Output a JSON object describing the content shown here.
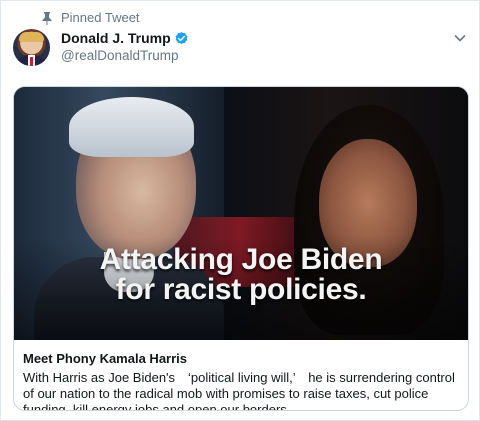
{
  "pinned": {
    "label": "Pinned Tweet",
    "icon": "pin-icon"
  },
  "author": {
    "name": "Donald J. Trump",
    "handle": "@realDonaldTrump",
    "verified_icon": "verified-badge-icon",
    "verified_color": "#1da1f2"
  },
  "menu": {
    "icon": "chevron-down-icon"
  },
  "card": {
    "media_text_line1": "Attacking Joe Biden",
    "media_text_line2": "for racist policies.",
    "title": "Meet Phony Kamala Harris",
    "description": "With Harris as Joe Biden's　‘political living will,’　he is surrendering control of our nation to the radical mob with promises to raise taxes, cut police funding, kill energy jobs and open our borders."
  },
  "colors": {
    "text_primary": "#14171a",
    "text_secondary": "#657786",
    "border": "#ccd6dd"
  }
}
